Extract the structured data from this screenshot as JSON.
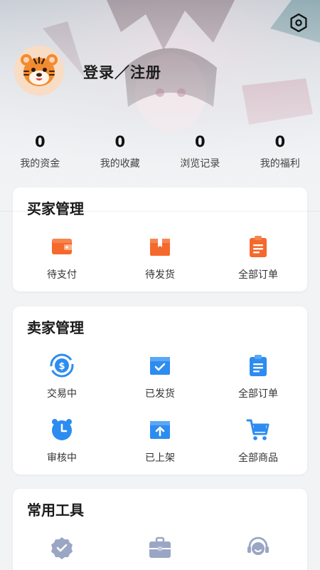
{
  "header": {
    "login_label": "登录／注册",
    "settings_icon": "settings-hexagon-icon",
    "avatar_icon": "tiger-avatar-icon"
  },
  "stats": [
    {
      "value": "0",
      "label": "我的资金"
    },
    {
      "value": "0",
      "label": "我的收藏"
    },
    {
      "value": "0",
      "label": "浏览记录"
    },
    {
      "value": "0",
      "label": "我的福利"
    }
  ],
  "buyer": {
    "title": "买家管理",
    "items": [
      {
        "label": "待支付",
        "icon": "wallet-icon"
      },
      {
        "label": "待发货",
        "icon": "package-icon"
      },
      {
        "label": "全部订单",
        "icon": "clipboard-icon"
      }
    ]
  },
  "seller": {
    "title": "卖家管理",
    "items": [
      {
        "label": "交易中",
        "icon": "coin-exchange-icon"
      },
      {
        "label": "已发货",
        "icon": "shipped-box-icon"
      },
      {
        "label": "全部订单",
        "icon": "clipboard-icon"
      },
      {
        "label": "审核中",
        "icon": "alarm-clock-icon"
      },
      {
        "label": "已上架",
        "icon": "upload-box-icon"
      },
      {
        "label": "全部商品",
        "icon": "shopping-cart-icon"
      }
    ]
  },
  "tools": {
    "title": "常用工具",
    "items": [
      {
        "icon": "verified-badge-icon"
      },
      {
        "icon": "toolbox-icon"
      },
      {
        "icon": "customer-service-icon"
      }
    ]
  },
  "colors": {
    "buyer_accent": "#f5692c",
    "seller_accent": "#2d8cf0",
    "tools_accent": "#9aa6c4"
  }
}
